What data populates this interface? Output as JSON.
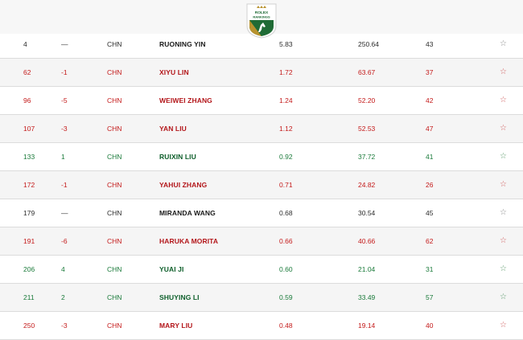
{
  "logo": {
    "brand": "ROLEX",
    "label": "RANKINGS"
  },
  "rows": [
    {
      "rank": "4",
      "move": "—",
      "country": "CHN",
      "name": "RUONING YIN",
      "avg": "5.83",
      "points": "250.64",
      "events": "43",
      "star": "☆",
      "trend": "same"
    },
    {
      "rank": "62",
      "move": "-1",
      "country": "CHN",
      "name": "XIYU LIN",
      "avg": "1.72",
      "points": "63.67",
      "events": "37",
      "star": "☆",
      "trend": "down"
    },
    {
      "rank": "96",
      "move": "-5",
      "country": "CHN",
      "name": "WEIWEI ZHANG",
      "avg": "1.24",
      "points": "52.20",
      "events": "42",
      "star": "☆",
      "trend": "down"
    },
    {
      "rank": "107",
      "move": "-3",
      "country": "CHN",
      "name": "YAN LIU",
      "avg": "1.12",
      "points": "52.53",
      "events": "47",
      "star": "☆",
      "trend": "down"
    },
    {
      "rank": "133",
      "move": "1",
      "country": "CHN",
      "name": "RUIXIN LIU",
      "avg": "0.92",
      "points": "37.72",
      "events": "41",
      "star": "☆",
      "trend": "up"
    },
    {
      "rank": "172",
      "move": "-1",
      "country": "CHN",
      "name": "YAHUI ZHANG",
      "avg": "0.71",
      "points": "24.82",
      "events": "26",
      "star": "☆",
      "trend": "down"
    },
    {
      "rank": "179",
      "move": "—",
      "country": "CHN",
      "name": "MIRANDA WANG",
      "avg": "0.68",
      "points": "30.54",
      "events": "45",
      "star": "☆",
      "trend": "same"
    },
    {
      "rank": "191",
      "move": "-6",
      "country": "CHN",
      "name": "HARUKA MORITA",
      "avg": "0.66",
      "points": "40.66",
      "events": "62",
      "star": "☆",
      "trend": "down"
    },
    {
      "rank": "206",
      "move": "4",
      "country": "CHN",
      "name": "YUAI JI",
      "avg": "0.60",
      "points": "21.04",
      "events": "31",
      "star": "☆",
      "trend": "up"
    },
    {
      "rank": "211",
      "move": "2",
      "country": "CHN",
      "name": "SHUYING LI",
      "avg": "0.59",
      "points": "33.49",
      "events": "57",
      "star": "☆",
      "trend": "up"
    },
    {
      "rank": "250",
      "move": "-3",
      "country": "CHN",
      "name": "MARY LIU",
      "avg": "0.48",
      "points": "19.14",
      "events": "40",
      "star": "☆",
      "trend": "down"
    }
  ]
}
